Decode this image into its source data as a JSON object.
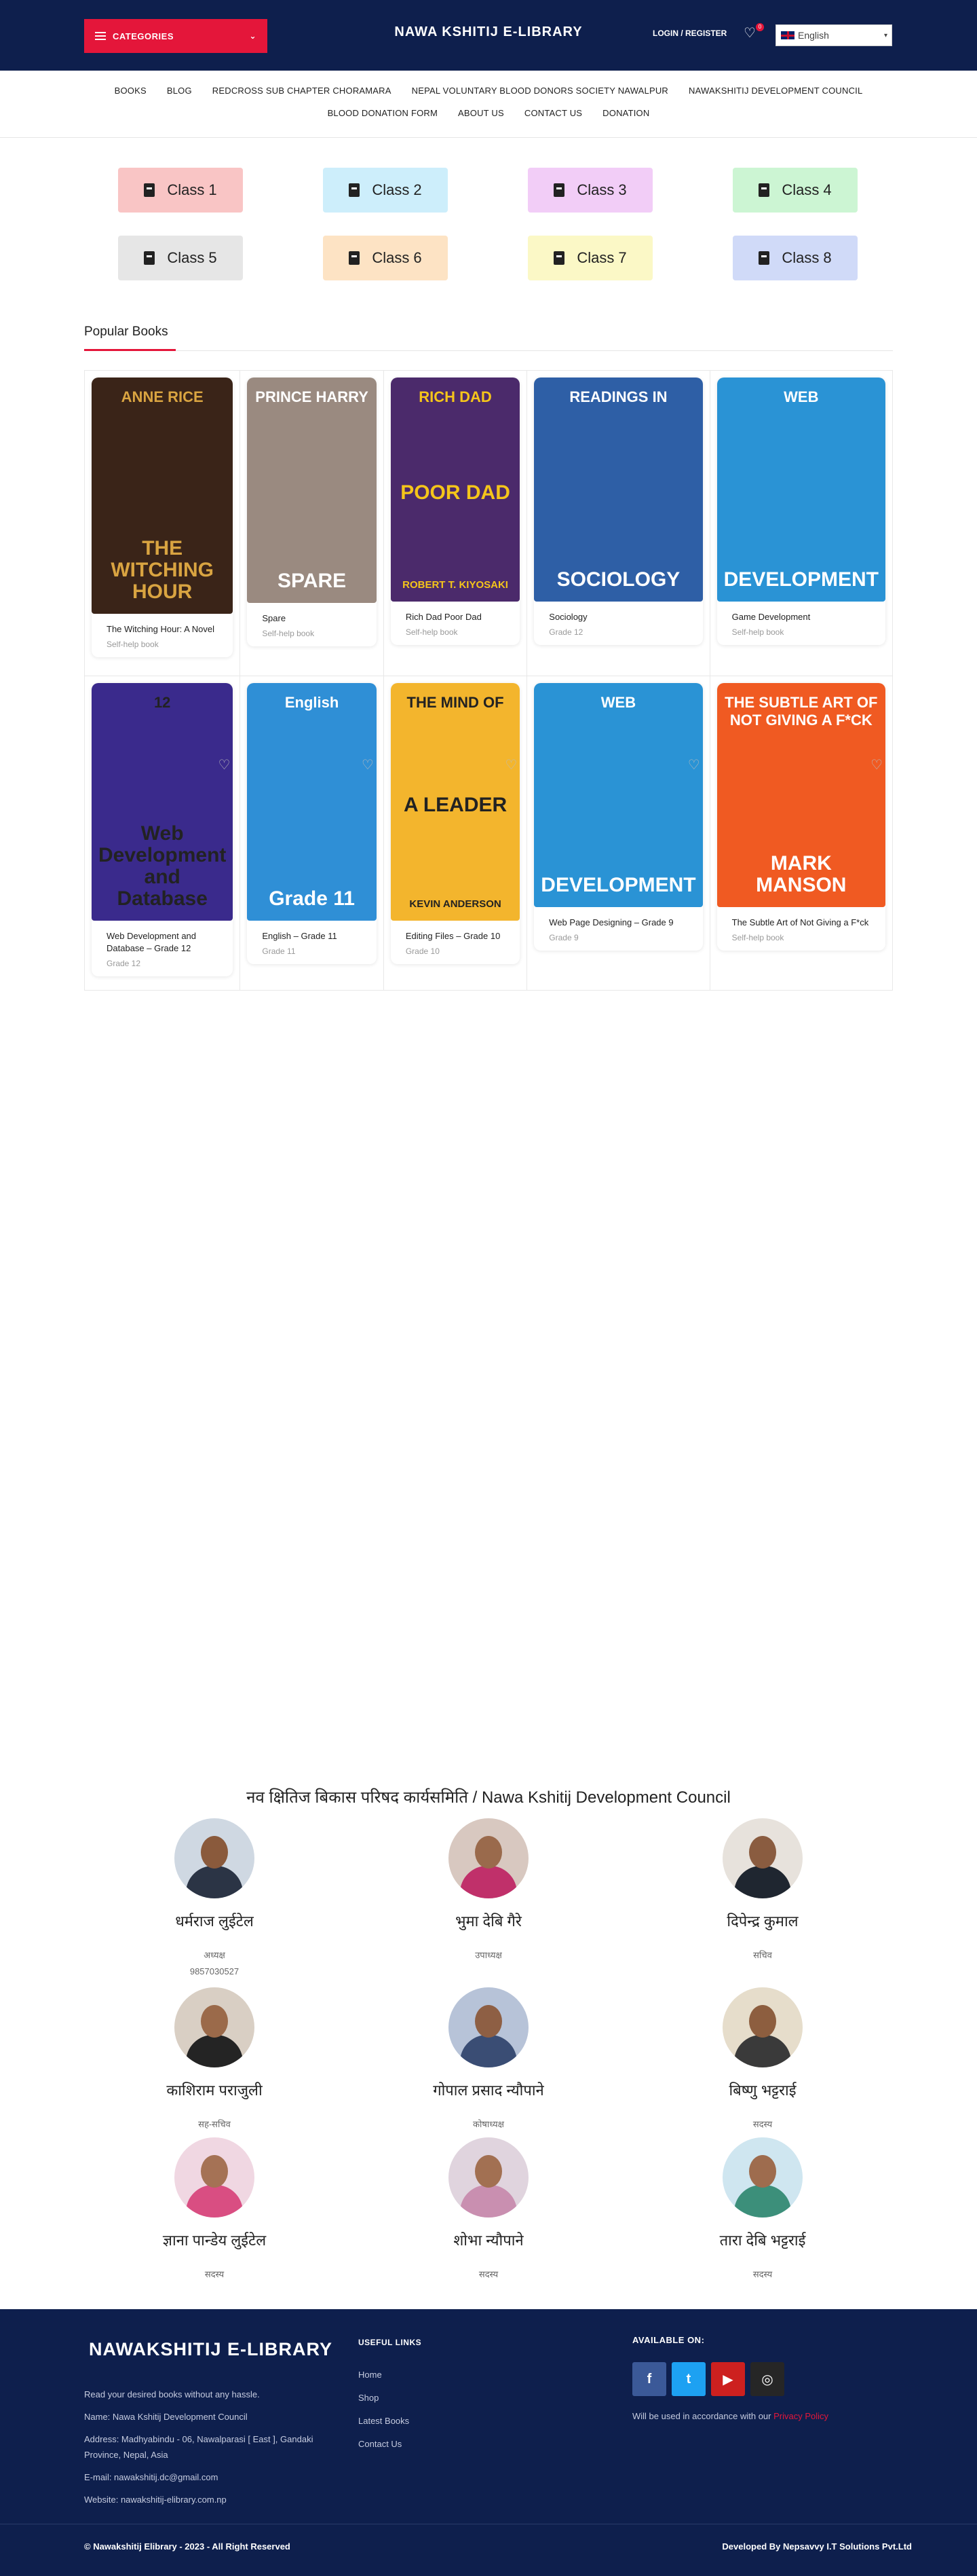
{
  "header": {
    "categories_label": "CATEGORIES",
    "logo": "NAWA KSHITIJ E-LIBRARY",
    "login_label": "LOGIN / REGISTER",
    "wishlist_count": "0",
    "language": "English"
  },
  "nav": {
    "row1": [
      "BOOKS",
      "BLOG",
      "REDCROSS SUB CHAPTER CHORAMARA",
      "NEPAL VOLUNTARY BLOOD DONORS SOCIETY NAWALPUR",
      "NAWAKSHITIJ DEVELOPMENT COUNCIL"
    ],
    "row2": [
      "BLOOD DONATION FORM",
      "ABOUT US",
      "CONTACT US",
      "DONATION"
    ]
  },
  "classes": [
    {
      "label": "Class 1",
      "color": "#f9c5c5"
    },
    {
      "label": "Class 2",
      "color": "#cdeefb"
    },
    {
      "label": "Class 3",
      "color": "#f2cdf7"
    },
    {
      "label": "Class 4",
      "color": "#ccf5d3"
    },
    {
      "label": "Class 5",
      "color": "#e6e6e6"
    },
    {
      "label": "Class 6",
      "color": "#fde3c4"
    },
    {
      "label": "Class 7",
      "color": "#fbf8c6"
    },
    {
      "label": "Class 8",
      "color": "#d0daf8"
    }
  ],
  "popular": {
    "title": "Popular Books",
    "books": [
      {
        "title": "The Witching Hour: A Novel",
        "category": "Self-help book",
        "cover": {
          "top": "ANNE RICE",
          "main": "THE WITCHING HOUR",
          "bg": "#3a2418",
          "accent": "#d9a441"
        }
      },
      {
        "title": "Spare",
        "category": "Self-help book",
        "cover": {
          "top": "PRINCE HARRY",
          "main": "SPARE",
          "bg": "#9a8a80",
          "accent": "#ffffff"
        }
      },
      {
        "title": "Rich Dad Poor Dad",
        "category": "Self-help book",
        "cover": {
          "top": "RICH DAD",
          "main": "POOR DAD",
          "bottom": "ROBERT T. KIYOSAKI",
          "bg": "#4b2a6b",
          "accent": "#f5c51a"
        }
      },
      {
        "title": "Sociology",
        "category": "Grade 12",
        "cover": {
          "top": "READINGS IN",
          "main": "SOCIOLOGY",
          "bg": "#2e5fa6",
          "accent": "#ffffff"
        }
      },
      {
        "title": "Game Development",
        "category": "Self-help book",
        "cover": {
          "top": "WEB",
          "main": "DEVELOPMENT",
          "bg": "#2a93d5",
          "accent": "#ffffff"
        }
      },
      {
        "title": "Web Development and Database – Grade 12",
        "category": "Grade 12",
        "cover": {
          "top": "12",
          "main": "Web Development and Database",
          "bg": "#3a2a8c",
          "accent": "#222222"
        }
      },
      {
        "title": "English – Grade 11",
        "category": "Grade 11",
        "cover": {
          "top": "English",
          "main": "Grade 11",
          "bg": "#2f8fd6",
          "accent": "#ffffff"
        }
      },
      {
        "title": "Editing Files – Grade 10",
        "category": "Grade 10",
        "cover": {
          "top": "THE MIND OF",
          "main": "A LEADER",
          "bottom": "KEVIN ANDERSON",
          "bg": "#f3b52d",
          "accent": "#222222"
        }
      },
      {
        "title": "Web Page Designing – Grade 9",
        "category": "Grade 9",
        "cover": {
          "top": "WEB",
          "main": "DEVELOPMENT",
          "bg": "#2a93d5",
          "accent": "#ffffff"
        }
      },
      {
        "title": "The Subtle Art of Not Giving a F*ck",
        "category": "Self-help book",
        "cover": {
          "top": "THE SUBTLE ART OF NOT GIVING A F*CK",
          "main": "MARK MANSON",
          "bg": "#f05a22",
          "accent": "#ffffff"
        }
      }
    ]
  },
  "council": {
    "title": "नव क्षितिज बिकास परिषद कार्यसमिति / Nawa Kshitij Development Council",
    "members": [
      {
        "name": "धर्मराज लुईटेल",
        "role": "अध्यक्ष",
        "phone": "9857030527",
        "skin": "#8a5a3c",
        "cloth": "#2b3445",
        "bg": "#cfd8e2"
      },
      {
        "name": "भुमा देबि गैरे",
        "role": "उपाध्यक्ष",
        "phone": "",
        "skin": "#9a6a4c",
        "cloth": "#c0306a",
        "bg": "#d8c8c0"
      },
      {
        "name": "दिपेन्द्र कुमाल",
        "role": "सचिव",
        "phone": "",
        "skin": "#8a5c40",
        "cloth": "#1f2630",
        "bg": "#e7e2dc"
      },
      {
        "name": "काशिराम पराजुली",
        "role": "सह-सचिव",
        "phone": "",
        "skin": "#9b6a4a",
        "cloth": "#242424",
        "bg": "#d9cfc4"
      },
      {
        "name": "गोपाल प्रसाद न्यौपाने",
        "role": "कोषाध्यक्ष",
        "phone": "",
        "skin": "#8e5f44",
        "cloth": "#3a4d74",
        "bg": "#b7c3d8"
      },
      {
        "name": "बिष्णु भट्टराई",
        "role": "सदस्य",
        "phone": "",
        "skin": "#8d5e3f",
        "cloth": "#3a3a3a",
        "bg": "#e6ddcb"
      },
      {
        "name": "ज्ञाना पान्डेय लुईटेल",
        "role": "सदस्य",
        "phone": "",
        "skin": "#a57255",
        "cloth": "#d94e82",
        "bg": "#f0d7e2"
      },
      {
        "name": "शोभा न्यौपाने",
        "role": "सदस्य",
        "phone": "",
        "skin": "#a27052",
        "cloth": "#c98fb0",
        "bg": "#e0d4de"
      },
      {
        "name": "तारा देबि भट्टराई",
        "role": "सदस्य",
        "phone": "",
        "skin": "#9e6c4e",
        "cloth": "#3c8f7a",
        "bg": "#cfe6f0"
      }
    ]
  },
  "footer": {
    "logo": "NAWAKSHITIJ E-LIBRARY",
    "desc": [
      "Read your desired books without any hassle.",
      "Name: Nawa Kshitij Development Council",
      "Address: Madhyabindu - 06, Nawalparasi [ East ], Gandaki",
      "Province, Nepal, Asia",
      "E-mail: nawakshitij.dc@gmail.com",
      "Website: nawakshitij-elibrary.com.np"
    ],
    "links_title": "USEFUL LINKS",
    "links": [
      "Home",
      "Shop",
      "Latest Books",
      "Contact Us"
    ],
    "available_title": "AVAILABLE ON:",
    "socials": [
      {
        "name": "facebook",
        "glyph": "f",
        "color": "#3b5998"
      },
      {
        "name": "twitter",
        "glyph": "t",
        "color": "#1da1f2"
      },
      {
        "name": "youtube",
        "glyph": "▶",
        "color": "#cd201f"
      },
      {
        "name": "instagram",
        "glyph": "◎",
        "color": "#262626"
      }
    ],
    "note_prefix": "Will be used in accordance with our ",
    "note_link": "Privacy Policy",
    "copyright": "© Nawakshitij Elibrary - 2023 - All Right Reserved",
    "developer": "Developed By Nepsavvy I.T Solutions Pvt.Ltd"
  }
}
